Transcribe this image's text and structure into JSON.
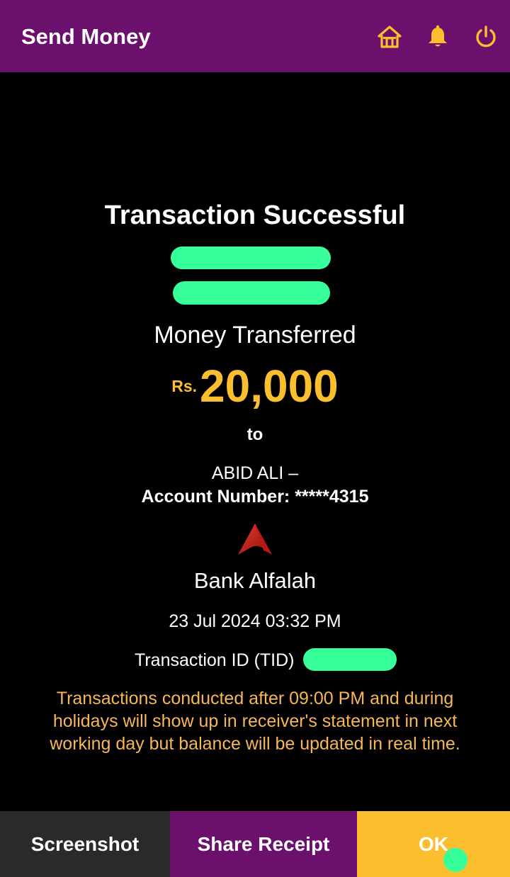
{
  "header": {
    "title": "Send Money",
    "icons": [
      "home-icon",
      "bell-icon",
      "power-icon"
    ],
    "background": "#6b116d",
    "icon_color": "#fbbe2e"
  },
  "receipt": {
    "title": "Transaction Successful",
    "money_label": "Money Transferred",
    "currency": "Rs.",
    "amount": "20,000",
    "to_label": "to",
    "recipient": "ABID ALI –",
    "account": "Account Number: *****4315",
    "bank": "Bank Alfalah",
    "datetime": "23 Jul 2024 03:32 PM",
    "tid_label": "Transaction ID (TID)",
    "notice": "Transactions conducted after 09:00 PM and during holidays will show up in receiver's statement in next working day but balance will be updated in real time.",
    "accent": "#fbbe2e",
    "notice_color": "#f6b65a"
  },
  "actions": {
    "screenshot": "Screenshot",
    "share": "Share Receipt",
    "ok": "OK"
  }
}
